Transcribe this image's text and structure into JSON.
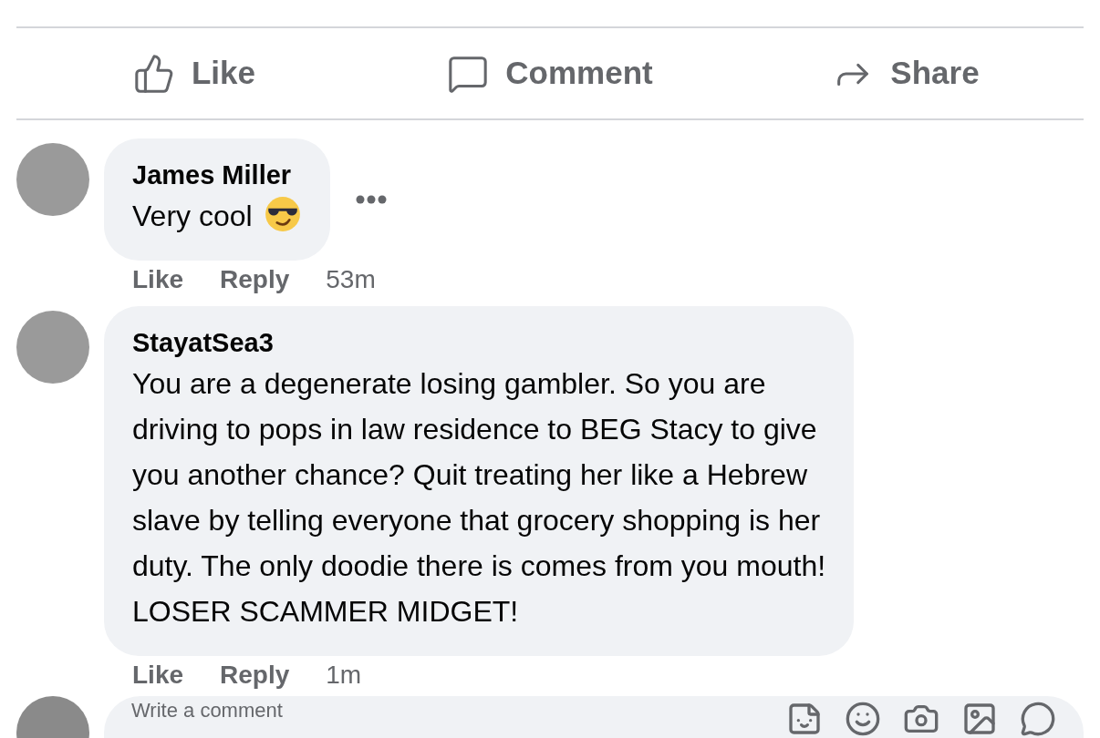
{
  "actions": [
    {
      "kind": "like",
      "label": "Like"
    },
    {
      "kind": "comment",
      "label": "Comment"
    },
    {
      "kind": "share",
      "label": "Share"
    }
  ],
  "comments": [
    {
      "author": "James Miller",
      "lines": [
        "Very cool"
      ],
      "trailing_emoji": true,
      "more_menu": true,
      "like": "Like",
      "reply": "Reply",
      "time": "53m"
    },
    {
      "author": "StayatSea3",
      "lines": [
        "You are a degenerate losing gambler. So you are",
        "driving to pops in law residence to BEG Stacy to give",
        "you another chance? Quit treating her like a Hebrew",
        "slave by telling everyone that grocery shopping is her",
        "duty. The only doodie there is comes from you mouth!",
        "LOSER SCAMMER MIDGET!"
      ],
      "trailing_emoji": false,
      "more_menu": false,
      "like": "Like",
      "reply": "Reply",
      "time": "1m"
    }
  ],
  "composer": {
    "placeholder": "Write a comment"
  }
}
